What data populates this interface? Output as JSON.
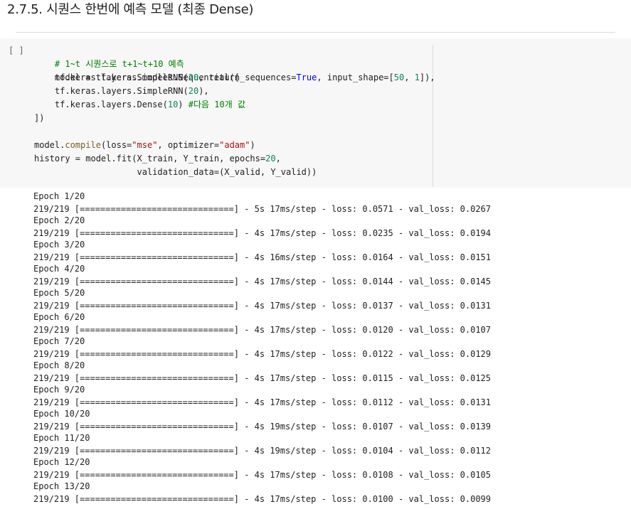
{
  "section": {
    "title": "2.7.5. 시퀀스 한번에 예측 모델 (최종 Dense)"
  },
  "cell": {
    "run_label": "[ ]",
    "code": {
      "l1_comment": "# 1~t 시퀀스로 t+1~t+10 예측",
      "l2_a": "model = tf.keras.models.Sequential([",
      "l3_a": "    tf.keras.layers.SimpleRNN(",
      "l3_n1": "20",
      "l3_b": ", return_sequences=",
      "l3_kw": "True",
      "l3_c": ", input_shape=[",
      "l3_n2": "50",
      "l3_d": ", ",
      "l3_n3": "1",
      "l3_e": "]),",
      "l4_a": "    tf.keras.layers.SimpleRNN(",
      "l4_n": "20",
      "l4_b": "),",
      "l5_a": "    tf.keras.layers.Dense(",
      "l5_n": "10",
      "l5_b": ") ",
      "l5_comment": "#다음 10개 값",
      "l6": "])",
      "l8_a": "model.",
      "l8_fn": "compile",
      "l8_b": "(loss=",
      "l8_s1": "\"mse\"",
      "l8_c": ", optimizer=",
      "l8_s2": "\"adam\"",
      "l8_d": ")",
      "l9_a": "history = model.fit(X_train, Y_train, epochs=",
      "l9_n": "20",
      "l9_b": ",",
      "l10": "                    validation_data=(X_valid, Y_valid))"
    }
  },
  "output": {
    "epochs": [
      {
        "header": "Epoch 1/20",
        "progress": "219/219 [==============================] - 5s 17ms/step - loss: 0.0571 - val_loss: 0.0267"
      },
      {
        "header": "Epoch 2/20",
        "progress": "219/219 [==============================] - 4s 17ms/step - loss: 0.0235 - val_loss: 0.0194"
      },
      {
        "header": "Epoch 3/20",
        "progress": "219/219 [==============================] - 4s 16ms/step - loss: 0.0164 - val_loss: 0.0151"
      },
      {
        "header": "Epoch 4/20",
        "progress": "219/219 [==============================] - 4s 17ms/step - loss: 0.0144 - val_loss: 0.0145"
      },
      {
        "header": "Epoch 5/20",
        "progress": "219/219 [==============================] - 4s 17ms/step - loss: 0.0137 - val_loss: 0.0131"
      },
      {
        "header": "Epoch 6/20",
        "progress": "219/219 [==============================] - 4s 17ms/step - loss: 0.0120 - val_loss: 0.0107"
      },
      {
        "header": "Epoch 7/20",
        "progress": "219/219 [==============================] - 4s 17ms/step - loss: 0.0122 - val_loss: 0.0129"
      },
      {
        "header": "Epoch 8/20",
        "progress": "219/219 [==============================] - 4s 17ms/step - loss: 0.0115 - val_loss: 0.0125"
      },
      {
        "header": "Epoch 9/20",
        "progress": "219/219 [==============================] - 4s 17ms/step - loss: 0.0112 - val_loss: 0.0131"
      },
      {
        "header": "Epoch 10/20",
        "progress": "219/219 [==============================] - 4s 19ms/step - loss: 0.0107 - val_loss: 0.0139"
      },
      {
        "header": "Epoch 11/20",
        "progress": "219/219 [==============================] - 4s 19ms/step - loss: 0.0104 - val_loss: 0.0112"
      },
      {
        "header": "Epoch 12/20",
        "progress": "219/219 [==============================] - 4s 17ms/step - loss: 0.0108 - val_loss: 0.0105"
      },
      {
        "header": "Epoch 13/20",
        "progress": "219/219 [==============================] - 4s 17ms/step - loss: 0.0100 - val_loss: 0.0099"
      }
    ]
  }
}
